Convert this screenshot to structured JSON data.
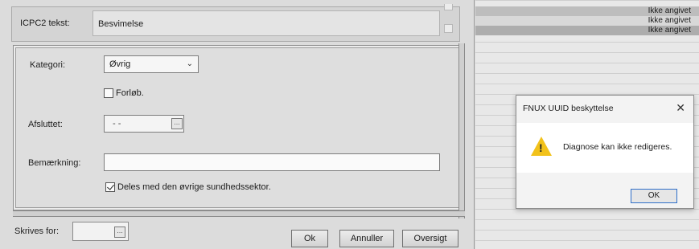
{
  "icpc": {
    "label": "ICPC2 tekst:",
    "value": "Besvimelse"
  },
  "form": {
    "kategori_label": "Kategori:",
    "kategori_value": "Øvrig",
    "forloeb_label": "Forløb.",
    "forloeb_checked": false,
    "afsluttet_label": "Afsluttet:",
    "afsluttet_value": "- -",
    "bemaerkning_label": "Bemærkning:",
    "bemaerkning_value": "",
    "deles_label": "Deles med den øvrige sundhedssektor.",
    "deles_checked": true
  },
  "footer": {
    "skrives_label": "Skrives for:",
    "skrives_value": "",
    "ok_label": "Ok",
    "annuller_label": "Annuller",
    "oversigt_label": "Oversigt"
  },
  "status_rows": [
    "Ikke angivet",
    "Ikke angivet",
    "Ikke angivet"
  ],
  "message_box": {
    "title": "FNUX UUID beskyttelse",
    "text": "Diagnose kan ikke redigeres.",
    "ok_label": "OK",
    "icon": "warning-icon",
    "accent_color": "#2f6fc9"
  }
}
